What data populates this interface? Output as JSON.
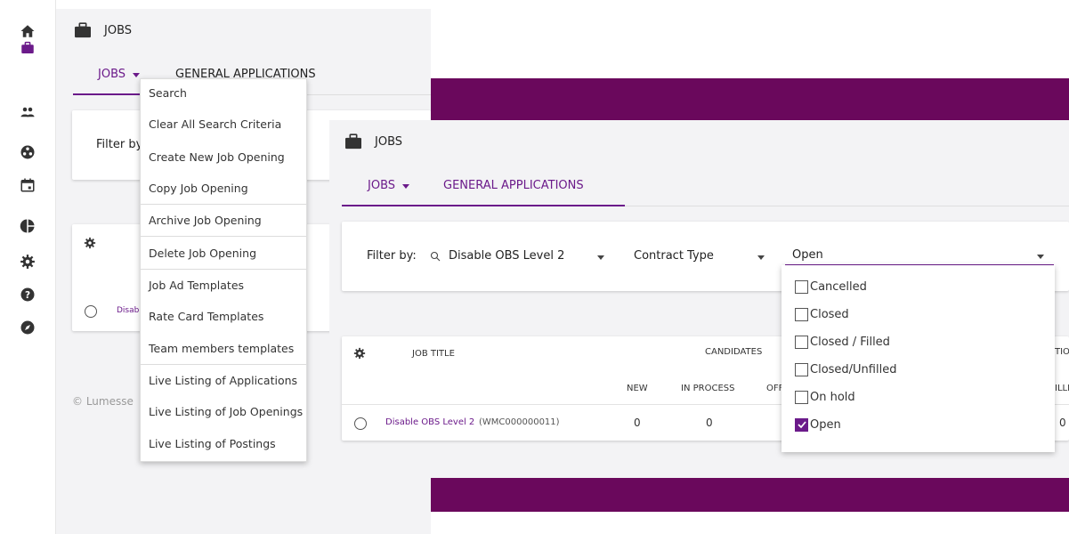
{
  "sidebar": {
    "items": [
      {
        "icon": "home-icon"
      },
      {
        "icon": "briefcase-icon"
      },
      {
        "icon": "people-icon"
      },
      {
        "icon": "network-icon"
      },
      {
        "icon": "calendar-icon"
      },
      {
        "icon": "pie-chart-icon"
      },
      {
        "icon": "gear-icon"
      },
      {
        "icon": "help-icon"
      },
      {
        "icon": "compass-icon"
      }
    ],
    "active_color": "#6b1a8a"
  },
  "back_panel": {
    "title": "JOBS",
    "tabs": [
      "JOBS",
      "GENERAL APPLICATIONS"
    ],
    "filter_label": "Filter by",
    "row_link": "Disab",
    "footer": "© Lumesse"
  },
  "menu": {
    "items": [
      "Search",
      "Clear All Search Criteria",
      "Create New Job Opening",
      "Copy Job Opening",
      "Archive Job Opening",
      "Delete Job Opening",
      "Job Ad Templates",
      "Rate Card Templates",
      "Team members templates",
      "Live Listing of Applications",
      "Live Listing of Job Openings",
      "Live Listing of Postings"
    ]
  },
  "front_panel": {
    "title": "JOBS",
    "tabs": [
      "JOBS",
      "GENERAL APPLICATIONS"
    ],
    "filter": {
      "label": "Filter by:",
      "search_value": "Disable OBS Level 2",
      "contract_type": "Contract Type",
      "status_value": "Open"
    },
    "table": {
      "col_job_title": "JOB TITLE",
      "col_candidates": "CANDIDATES",
      "col_new": "NEW",
      "col_in_process": "IN PROCESS",
      "col_offer_partial": "OFF",
      "col_right_top": "TIO",
      "col_right_bottom": "ILLE",
      "row": {
        "title": "Disable OBS Level 2",
        "id": "(WMC000000011)",
        "new": "0",
        "in_process": "0",
        "right": "0"
      }
    },
    "status_options": [
      {
        "label": "Cancelled",
        "checked": false
      },
      {
        "label": "Closed",
        "checked": false
      },
      {
        "label": "Closed / Filled",
        "checked": false
      },
      {
        "label": "Closed/Unfilled",
        "checked": false
      },
      {
        "label": "On hold",
        "checked": false
      },
      {
        "label": "Open",
        "checked": true
      }
    ]
  },
  "colors": {
    "accent": "#6b1a8a",
    "band": "#6a085c",
    "panel_bg": "#f3f3f5"
  }
}
